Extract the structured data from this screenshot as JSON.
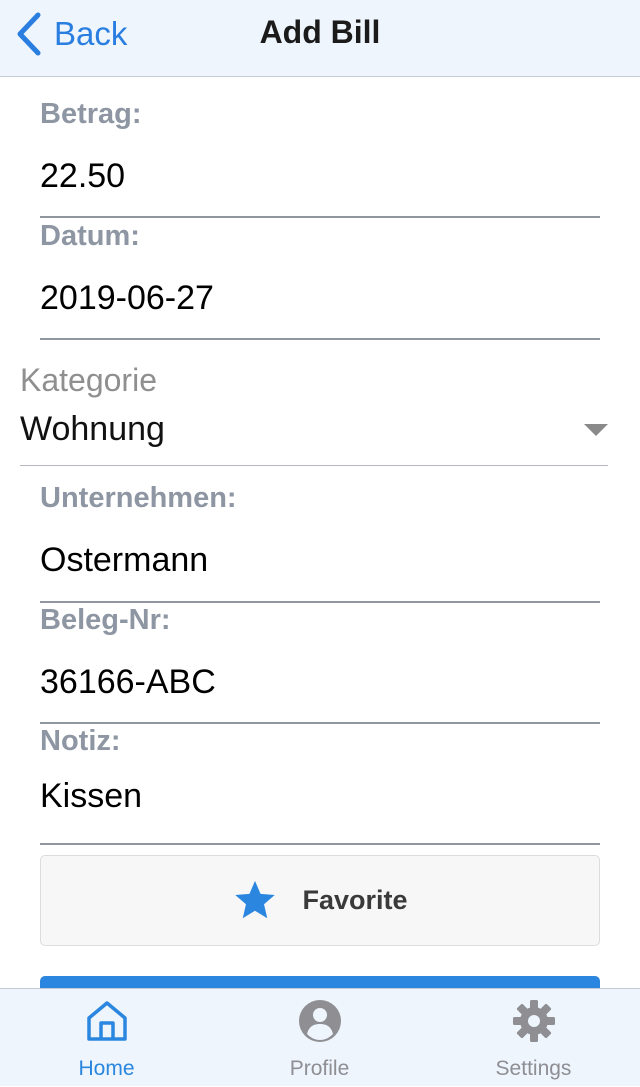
{
  "nav": {
    "back_label": "Back",
    "title": "Add Bill"
  },
  "form": {
    "betrag": {
      "label": "Betrag:",
      "value": "22.50"
    },
    "datum": {
      "label": "Datum:",
      "value": "2019-06-27"
    },
    "kategorie": {
      "label": "Kategorie",
      "selected": "Wohnung"
    },
    "unternehmen": {
      "label": "Unternehmen:",
      "value": "Ostermann"
    },
    "beleg_nr": {
      "label": "Beleg-Nr:",
      "value": "36166-ABC"
    },
    "notiz": {
      "label": "Notiz:",
      "value": "Kissen"
    }
  },
  "favorite": {
    "label": "Favorite",
    "icon": "star-icon",
    "color": "#2a86de"
  },
  "tabs": [
    {
      "label": "Home",
      "icon": "home-icon",
      "active": true
    },
    {
      "label": "Profile",
      "icon": "user-circle-icon",
      "active": false
    },
    {
      "label": "Settings",
      "icon": "gear-icon",
      "active": false
    }
  ],
  "colors": {
    "accent": "#2a86de",
    "tab_inactive": "#8e8e93",
    "label_gray": "#8d96a2"
  }
}
